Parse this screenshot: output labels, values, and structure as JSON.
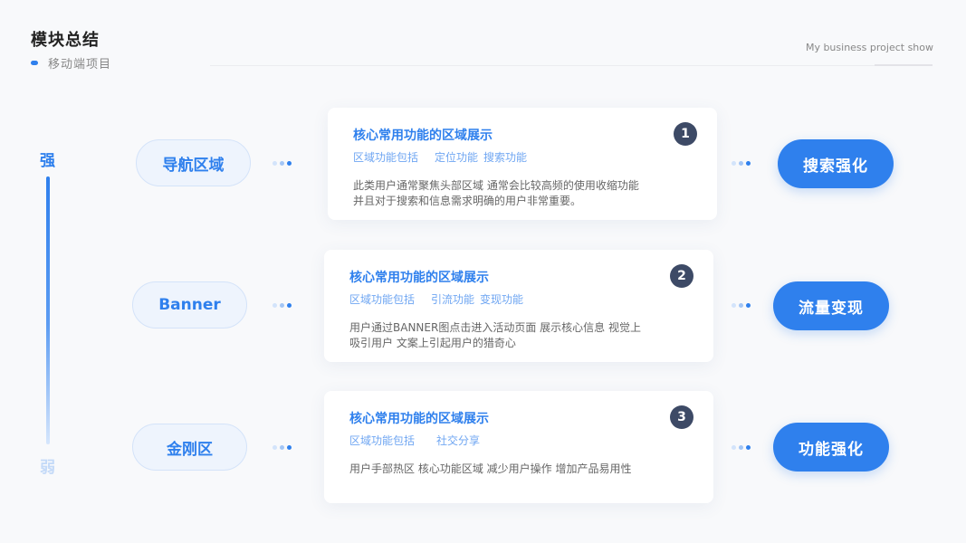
{
  "header": {
    "title": "模块总结",
    "subtitle": "移动端项目",
    "english": "My business project show"
  },
  "strength": {
    "top": "强",
    "bottom": "弱"
  },
  "colors": {
    "accent": "#2f80ed",
    "badge": "#3d4a66"
  },
  "rows": [
    {
      "left_label": "导航区域",
      "number": "1",
      "card_title": "核心常用功能的区域展示",
      "features_label": "区域功能包括",
      "features": [
        "定位功能",
        "搜索功能"
      ],
      "desc_lines": [
        "此类用户通常聚焦头部区域 通常会比较高频的使用收缩功能",
        "并且对于搜索和信息需求明确的用户非常重要。"
      ],
      "right_label": "搜索强化"
    },
    {
      "left_label": "Banner",
      "number": "2",
      "card_title": "核心常用功能的区域展示",
      "features_label": "区域功能包括",
      "features": [
        "引流功能",
        "变现功能"
      ],
      "desc_lines": [
        "用户通过BANNER图点击进入活动页面 展示核心信息 视觉上",
        "吸引用户 文案上引起用户的猎奇心"
      ],
      "right_label": "流量变现"
    },
    {
      "left_label": "金刚区",
      "number": "3",
      "card_title": "核心常用功能的区域展示",
      "features_label": "区域功能包括",
      "features": [
        "社交分享"
      ],
      "desc_lines": [
        "用户手部热区 核心功能区域 减少用户操作 增加产品易用性"
      ],
      "right_label": "功能强化"
    }
  ]
}
